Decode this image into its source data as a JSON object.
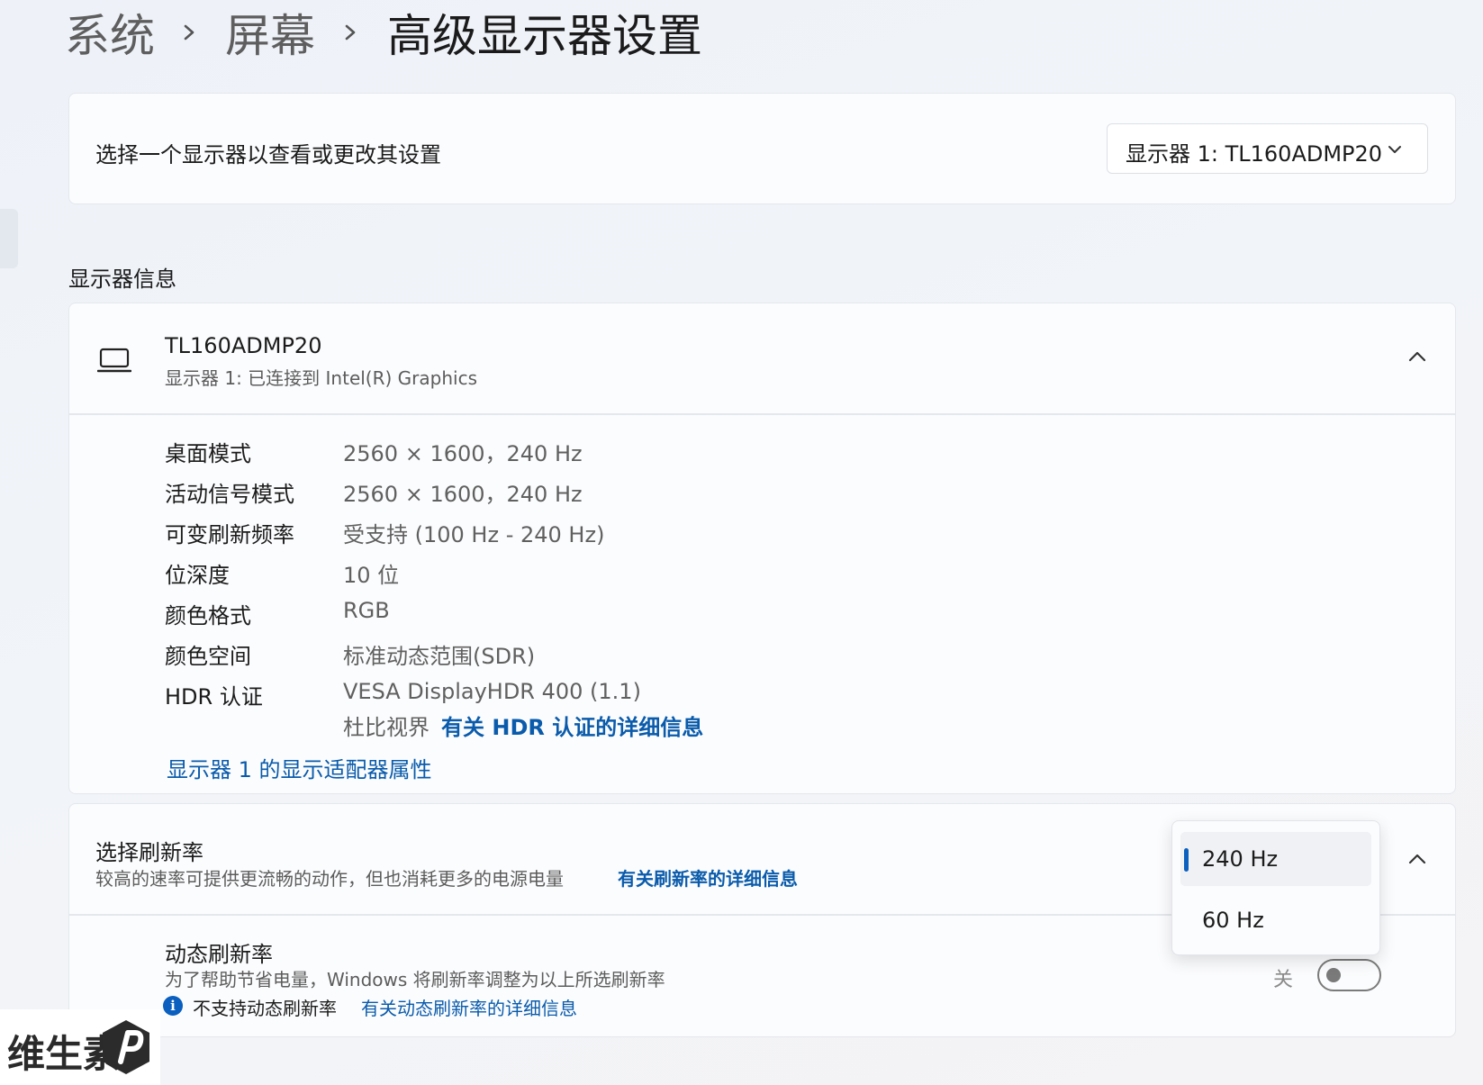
{
  "breadcrumb": {
    "items": [
      "系统",
      "屏幕"
    ],
    "current": "高级显示器设置"
  },
  "monitor_select": {
    "label": "选择一个显示器以查看或更改其设置",
    "selected": "显示器 1: TL160ADMP20"
  },
  "display_info": {
    "section_title": "显示器信息",
    "monitor_name": "TL160ADMP20",
    "monitor_subtitle": "显示器 1: 已连接到 Intel(R) Graphics",
    "rows": [
      {
        "label": "桌面模式",
        "value": "2560 × 1600，240 Hz"
      },
      {
        "label": "活动信号模式",
        "value": "2560 × 1600，240 Hz"
      },
      {
        "label": "可变刷新频率",
        "value": "受支持 (100 Hz - 240 Hz)"
      },
      {
        "label": "位深度",
        "value": "10 位"
      },
      {
        "label": "颜色格式",
        "value": "RGB"
      },
      {
        "label": "颜色空间",
        "value": "标准动态范围(SDR)"
      },
      {
        "label": "HDR 认证",
        "value": "VESA DisplayHDR 400 (1.1)"
      }
    ],
    "hdr_extra": "杜比视界",
    "hdr_link": "有关 HDR 认证的详细信息",
    "adapter_link": "显示器 1 的显示适配器属性"
  },
  "refresh_rate": {
    "title": "选择刷新率",
    "description": "较高的速率可提供更流畅的动作，但也消耗更多的电源电量",
    "link": "有关刷新率的详细信息",
    "options": [
      "240 Hz",
      "60 Hz"
    ],
    "selected": "240 Hz"
  },
  "dynamic_refresh": {
    "title": "动态刷新率",
    "description": "为了帮助节省电量，Windows 将刷新率调整为以上所选刷新率",
    "info_text": "不支持动态刷新率",
    "info_link": "有关动态刷新率的详细信息",
    "toggle_label": "关",
    "toggle_on": false
  },
  "watermark": {
    "text": "维生素"
  },
  "colors": {
    "accent": "#0a5fbf",
    "link": "#0a5bab"
  }
}
